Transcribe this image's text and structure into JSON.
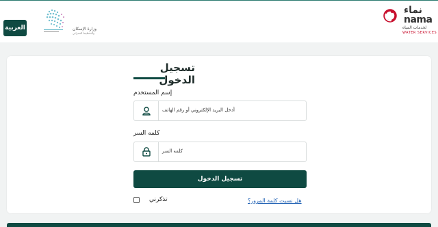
{
  "header": {
    "language_button": "العربية",
    "gov_logo_text_line1": "وزارة الإسكان",
    "gov_logo_text_line2": "والتخطيط العمراني",
    "nama_logo_ar": "نماء",
    "nama_logo_en": "nama",
    "nama_sub_ar": "لخدمات المياه",
    "nama_sub_en": "WATER SERVICES"
  },
  "login": {
    "title": "تسجيل الدخول",
    "username_label": "إسم المستخدم",
    "username_placeholder": "أدخل البريد الإلكتروني أو رقم الهاتف",
    "password_label": "كلمه السر",
    "password_placeholder": "كلمه السر",
    "submit_label": "تسجيل الدخول",
    "remember_label": "تذكرني",
    "forgot_label": "هل نسيت كلمة المرور؟"
  },
  "icons": {
    "user": "user-icon",
    "lock": "lock-icon"
  },
  "colors": {
    "brand_dark": "#0f4a42",
    "link": "#1d5fb3",
    "nama_red": "#c8102e"
  }
}
